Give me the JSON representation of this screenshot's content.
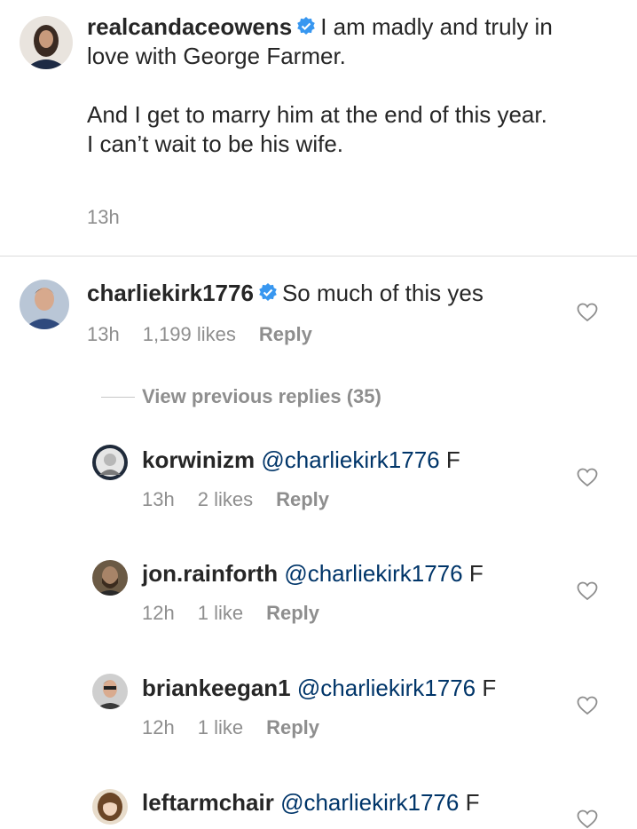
{
  "post": {
    "username": "realcandaceowens",
    "caption_line1": "I am madly and truly in love with George Farmer.",
    "caption_line2": "And I get to marry him at the end of this year.",
    "caption_line3": "I can’t wait to be his wife.",
    "time": "13h"
  },
  "comment": {
    "username": "charliekirk1776",
    "text": "So much of this yes",
    "time": "13h",
    "likes": "1,199 likes",
    "reply_label": "Reply"
  },
  "view_previous_replies": "View previous replies (35)",
  "replies": [
    {
      "username": "korwinizm",
      "mention": "@charliekirk1776",
      "text": "F",
      "time": "13h",
      "likes": "2 likes",
      "reply_label": "Reply"
    },
    {
      "username": "jon.rainforth",
      "mention": "@charliekirk1776",
      "text": "F",
      "time": "12h",
      "likes": "1 like",
      "reply_label": "Reply"
    },
    {
      "username": "briankeegan1",
      "mention": "@charliekirk1776",
      "text": "F",
      "time": "12h",
      "likes": "1 like",
      "reply_label": "Reply"
    },
    {
      "username": "leftarmchair",
      "mention": "@charliekirk1776",
      "text": "F"
    }
  ],
  "icons": {
    "verified": "verified-badge-icon",
    "heart": "heart-outline-icon"
  },
  "colors": {
    "verified_blue": "#3897f0",
    "text": "#262626",
    "secondary_text": "#8e8e8e",
    "mention": "#003569"
  }
}
